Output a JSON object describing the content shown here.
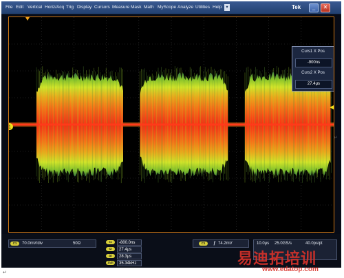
{
  "menubar": {
    "items": [
      "File",
      "Edit",
      "Vertical",
      "Horiz/Acq",
      "Trig",
      "Display",
      "Cursors",
      "Measure",
      "Mask",
      "Math",
      "MyScope",
      "Analyze",
      "Utilities",
      "Help"
    ],
    "help_arrow": "▾",
    "brand": "Tek",
    "minimize_glyph": "_",
    "close_glyph": "✕"
  },
  "cursor_panel": {
    "curs1_label": "Curs1 X Pos",
    "curs1_value": "-900ns",
    "curs2_label": "Curs2 X Pos",
    "curs2_value": "27.4μs"
  },
  "channel": {
    "tag": "C1",
    "scale": "70.0mV/div",
    "termination": "50Ω",
    "marker": "1"
  },
  "cursor_readout": {
    "rows": [
      {
        "tag": "t1",
        "value": "-800.0ns"
      },
      {
        "tag": "t2",
        "value": "27.4μs"
      },
      {
        "tag": "Δt",
        "value": "28.3μs"
      },
      {
        "tag": "1/Δt",
        "value": "35.34kHz"
      }
    ]
  },
  "trigger": {
    "tag": "C1",
    "slope_glyph": "ƒ",
    "level": "74.2mV"
  },
  "horizontal": {
    "scale": "10.0μs",
    "sample_rate": "25.0GS/s",
    "resolution": "40.0ps/pt"
  },
  "watermark": {
    "brand_text": "易迪拓培训",
    "url": "www.edatop.com"
  },
  "colors": {
    "menubar": "#2b4a7d",
    "graticule_border": "#d47a12",
    "trace_core": "#ff3a1a",
    "trace_mid": "#ff8a1a",
    "trace_outer": "#b8e030",
    "trigger_marker": "#f2e21a",
    "watermark": "#d8322a"
  },
  "waveform": {
    "bursts": [
      {
        "start_us": -21.3,
        "end_us": -1.4
      },
      {
        "start_us": 2.4,
        "end_us": 22.5
      },
      {
        "start_us": 26.4,
        "end_us": 46.2
      }
    ],
    "x_range_us": [
      -27.6,
      46.7
    ],
    "burst_peak_divisions": 1.95,
    "baseline_noise_divisions": 0.08
  }
}
